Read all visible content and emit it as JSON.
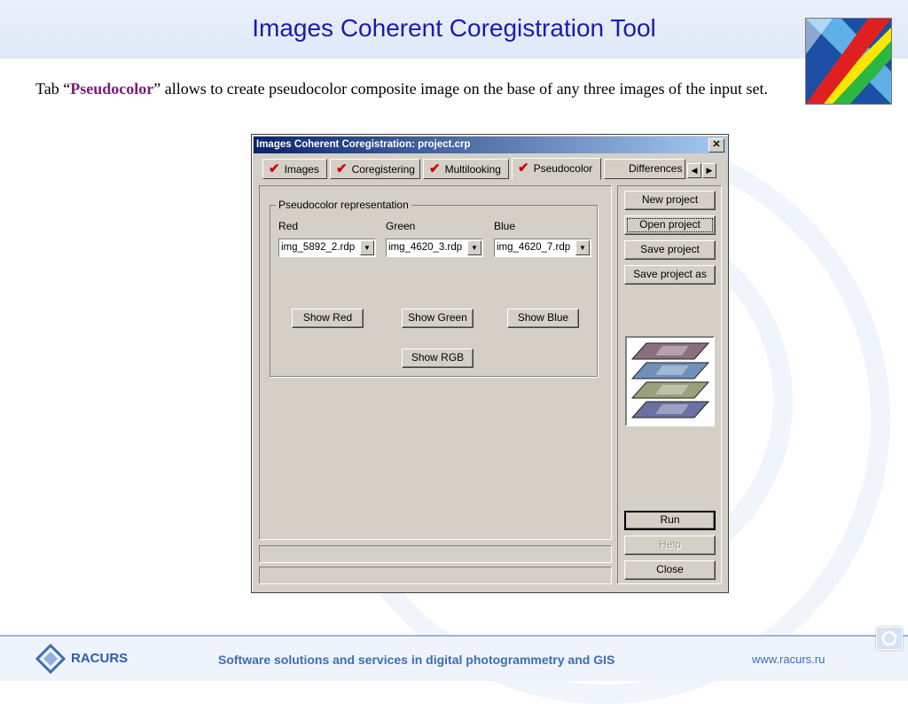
{
  "slide": {
    "title": "Images Coherent Coregistration Tool",
    "intro_prefix": "Tab “",
    "intro_tab": "Pseudocolor",
    "intro_suffix": "” allows to create pseudocolor composite image on the base of any three images of the input set."
  },
  "dialog": {
    "title": "Images Coherent Coregistration: project.crp",
    "close_glyph": "✕",
    "tabs": [
      {
        "label": "Images",
        "checked": true
      },
      {
        "label": "Coregistering",
        "checked": true
      },
      {
        "label": "Multilooking",
        "checked": true
      },
      {
        "label": "Pseudocolor",
        "checked": true,
        "active": true
      },
      {
        "label": "Differences",
        "checked": false
      }
    ],
    "tab_check": "✔",
    "scroll_left": "◀",
    "scroll_right": "▶",
    "group_title": "Pseudocolor representation",
    "channels": [
      {
        "label": "Red",
        "value": "img_5892_2.rdp"
      },
      {
        "label": "Green",
        "value": "img_4620_3.rdp"
      },
      {
        "label": "Blue",
        "value": "img_4620_7.rdp"
      }
    ],
    "combo_arrow": "▼",
    "buttons": {
      "show_red": "Show Red",
      "show_green": "Show Green",
      "show_blue": "Show Blue",
      "show_rgb": "Show RGB"
    },
    "side_buttons": {
      "new_project": "New project",
      "open_project": "Open project",
      "save_project": "Save project",
      "save_project_as": "Save project as",
      "run": "Run",
      "help": "Help",
      "close": "Close"
    },
    "layer_colors": [
      "#8a6f80",
      "#6f90b8",
      "#9aa07a",
      "#6a70a0"
    ]
  },
  "footer": {
    "brand": "RACURS",
    "tagline": "Software solutions and services in digital photogrammetry and GIS",
    "site": "www.racurs.ru"
  },
  "colors": {
    "title": "#1a1ab4",
    "tab_word": "#7a1c7e",
    "footer_text": "#3a6fb3"
  }
}
